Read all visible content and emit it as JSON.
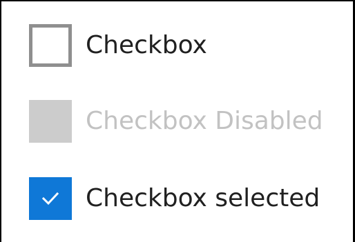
{
  "checkboxes": [
    {
      "label": "Checkbox",
      "state": "unchecked",
      "enabled": true
    },
    {
      "label": "Checkbox Disabled",
      "state": "unchecked",
      "enabled": false
    },
    {
      "label": "Checkbox selected",
      "state": "checked",
      "enabled": true
    }
  ],
  "colors": {
    "accent": "#0f78d7",
    "unchecked_border": "#8f8f8f",
    "disabled_fill": "#cccccc",
    "disabled_text": "#c2c2c2",
    "text": "#202020"
  },
  "icons": {
    "checkmark": "checkmark-icon"
  }
}
